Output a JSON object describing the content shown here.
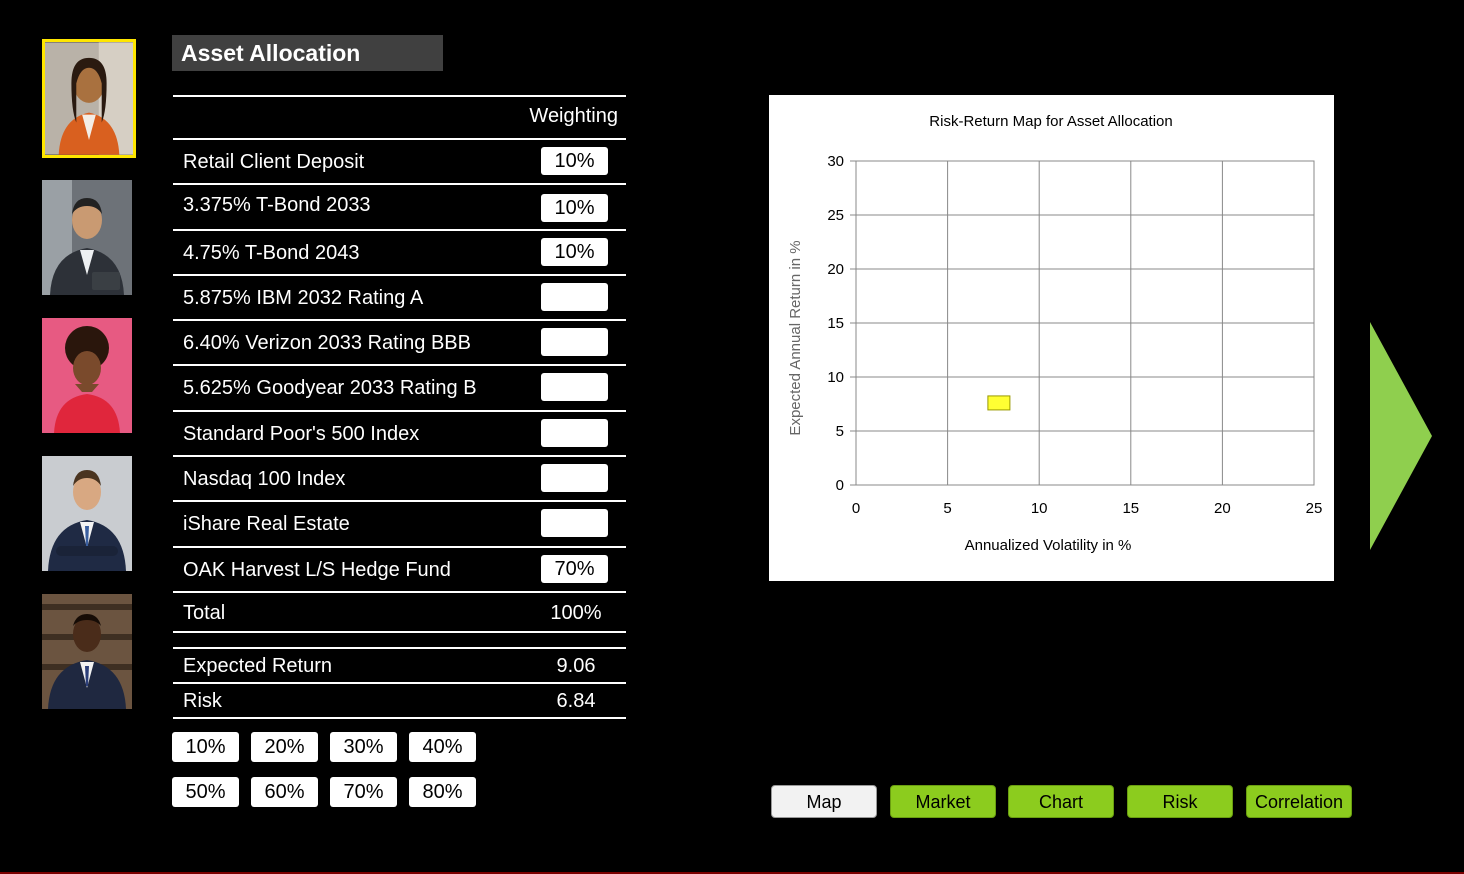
{
  "sidebar": {
    "avatars": [
      {
        "name": "advisor-1",
        "selected": true
      },
      {
        "name": "advisor-2",
        "selected": false
      },
      {
        "name": "advisor-3",
        "selected": false
      },
      {
        "name": "advisor-4",
        "selected": false
      },
      {
        "name": "advisor-5",
        "selected": false
      }
    ]
  },
  "allocation": {
    "title": "Asset Allocation",
    "weighting_header": "Weighting",
    "assets": [
      {
        "label": "Retail Client Deposit",
        "value": "10%"
      },
      {
        "label": "3.375% T-Bond 2033",
        "value": "10%"
      },
      {
        "label": "4.75% T-Bond 2043",
        "value": "10%"
      },
      {
        "label": "5.875% IBM 2032 Rating A",
        "value": ""
      },
      {
        "label": "6.40% Verizon 2033 Rating BBB",
        "value": ""
      },
      {
        "label": "5.625% Goodyear 2033 Rating B",
        "value": ""
      },
      {
        "label": "Standard Poor's 500 Index",
        "value": ""
      },
      {
        "label": "Nasdaq 100 Index",
        "value": ""
      },
      {
        "label": "iShare Real Estate",
        "value": ""
      },
      {
        "label": "OAK Harvest L/S Hedge Fund",
        "value": "70%"
      }
    ],
    "total_label": "Total",
    "total_value": "100%",
    "expected_return_label": "Expected Return",
    "expected_return_value": "9.06",
    "risk_label": "Risk",
    "risk_value": "6.84"
  },
  "presets": [
    "10%",
    "20%",
    "30%",
    "40%",
    "50%",
    "60%",
    "70%",
    "80%"
  ],
  "chart_data": {
    "type": "scatter",
    "title": "Risk-Return Map for Asset Allocation",
    "xlabel": "Annualized Volatility in %",
    "ylabel": "Expected Annual Return in %",
    "xlim": [
      0,
      25
    ],
    "ylim": [
      0,
      30
    ],
    "xticks": [
      0,
      5,
      10,
      15,
      20,
      25
    ],
    "yticks": [
      0,
      5,
      10,
      15,
      20,
      25,
      30
    ],
    "grid": true,
    "points": [
      {
        "x": 7.8,
        "y": 7.6
      }
    ],
    "marker_color": "#ffff33"
  },
  "nav": {
    "buttons": [
      {
        "label": "Map",
        "active": true
      },
      {
        "label": "Market",
        "active": false
      },
      {
        "label": "Chart",
        "active": false
      },
      {
        "label": "Risk",
        "active": false
      },
      {
        "label": "Correlation",
        "active": false
      }
    ]
  },
  "colors": {
    "accent_green": "#8ccc1e",
    "arrow_green": "#8fcf4e",
    "selected_border": "#ffe600"
  }
}
